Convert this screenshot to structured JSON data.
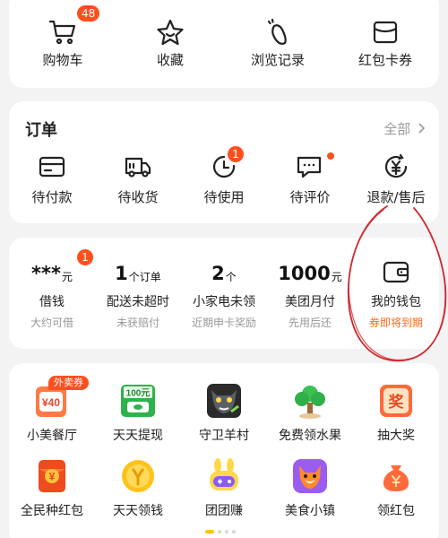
{
  "top_shortcuts": [
    {
      "label": "购物车",
      "icon": "shopping-cart-icon",
      "badge": "48"
    },
    {
      "label": "收藏",
      "icon": "star-icon"
    },
    {
      "label": "浏览记录",
      "icon": "footprint-icon"
    },
    {
      "label": "红包卡券",
      "icon": "card-voucher-icon"
    }
  ],
  "orders": {
    "title": "订单",
    "all_label": "全部",
    "items": [
      {
        "label": "待付款",
        "icon": "wallet-card-icon"
      },
      {
        "label": "待收货",
        "icon": "delivery-truck-icon"
      },
      {
        "label": "待使用",
        "icon": "clock-icon",
        "badge": "1"
      },
      {
        "label": "待评价",
        "icon": "comment-icon",
        "dot": true
      },
      {
        "label": "退款/售后",
        "icon": "refund-yen-icon"
      }
    ]
  },
  "finance": [
    {
      "value": "***",
      "unit": "元",
      "name": "借钱",
      "sub": "大约可借",
      "badge": "1"
    },
    {
      "value": "1",
      "unit": "个订单",
      "name": "配送未超时",
      "sub": "未获赔付"
    },
    {
      "value": "2",
      "unit": "个",
      "name": "小家电未领",
      "sub": "近期申卡奖励"
    },
    {
      "value": "1000",
      "unit": "元",
      "name": "美团月付",
      "sub": "先用后还"
    },
    {
      "icon": "wallet-icon",
      "name": "我的钱包",
      "sub": "券即将到期",
      "sub_warn": true
    }
  ],
  "services_row1": [
    {
      "label": "小美餐厅",
      "icon": "meal-coupon-icon",
      "tag": "外卖券",
      "icon_text": "¥40"
    },
    {
      "label": "天天提现",
      "icon": "cash-withdraw-icon",
      "icon_text": "100元"
    },
    {
      "label": "守卫羊村",
      "icon": "wolf-game-icon"
    },
    {
      "label": "免费领水果",
      "icon": "fruit-tree-icon"
    },
    {
      "label": "抽大奖",
      "icon": "lottery-icon",
      "icon_text": "奖"
    }
  ],
  "services_row2": [
    {
      "label": "全民种红包",
      "icon": "red-envelope-icon",
      "icon_text": "¥"
    },
    {
      "label": "天天领钱",
      "icon": "gold-coin-icon"
    },
    {
      "label": "团团赚",
      "icon": "bunny-game-icon"
    },
    {
      "label": "美食小镇",
      "icon": "fox-town-icon"
    },
    {
      "label": "领红包",
      "icon": "money-bag-icon"
    }
  ],
  "colors": {
    "accent": "#ff4f1f",
    "warn_text": "#ff6a1f",
    "annotation": "#d0282e",
    "pager_active": "#ffc400"
  }
}
